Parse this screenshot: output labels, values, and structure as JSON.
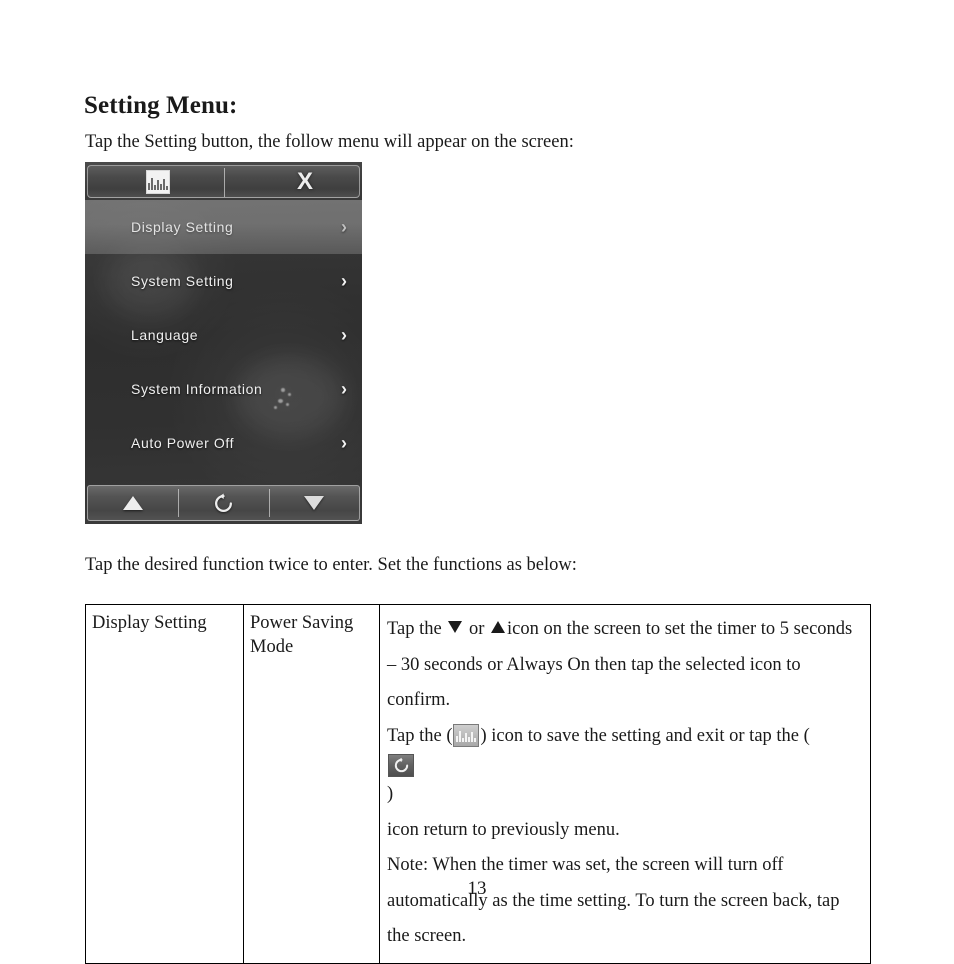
{
  "document": {
    "heading": "Setting Menu:",
    "intro_paragraph": "Tap the Setting button, the follow menu will appear on the screen:",
    "mid_paragraph": "Tap the desired function twice to enter. Set the functions as below:",
    "page_number": "13"
  },
  "device_screenshot": {
    "top_bar": {
      "save_icon": "save-icon",
      "close_label": "X"
    },
    "menu_items": [
      {
        "label": "Display Setting",
        "chevron": "›",
        "selected": true
      },
      {
        "label": "System Setting",
        "chevron": "›",
        "selected": false
      },
      {
        "label": "Language",
        "chevron": "›",
        "selected": false
      },
      {
        "label": "System Information",
        "chevron": "›",
        "selected": false
      },
      {
        "label": "Auto Power Off",
        "chevron": "›",
        "selected": false
      }
    ],
    "bottom_bar": {
      "up_icon": "triangle-up-icon",
      "return_icon": "circular-return-arrow-icon",
      "down_icon": "triangle-down-icon"
    },
    "colors": {
      "background_dark": "#343434",
      "bar_gray": "#4a4a4a",
      "highlight_row": "#b2b2b2",
      "text_light": "#f0f0f0"
    }
  },
  "table": {
    "rows": [
      {
        "function": "Display Setting",
        "sub_function": "Power Saving Mode",
        "description": {
          "line1_a": "Tap the",
          "line1_icon_down": "triangle-down-icon",
          "line1_b": "or",
          "line1_icon_up": "triangle-up-icon",
          "line1_c": "icon on the screen to set the timer to 5 seconds",
          "line2": "– 30 seconds or Always On then tap the selected icon to confirm.",
          "line3_a": "Tap the (",
          "line3_icon_save": "save-icon",
          "line3_b": ") icon to save the setting and exit or tap the (",
          "line3_icon_return": "circular-return-arrow-icon",
          "line3_c": ")",
          "line4": "icon return to previously menu.",
          "line5": "Note: When the timer was set, the screen will turn off",
          "line6": "automatically as the time setting. To turn the screen back, tap",
          "line7": "the screen."
        }
      }
    ]
  }
}
